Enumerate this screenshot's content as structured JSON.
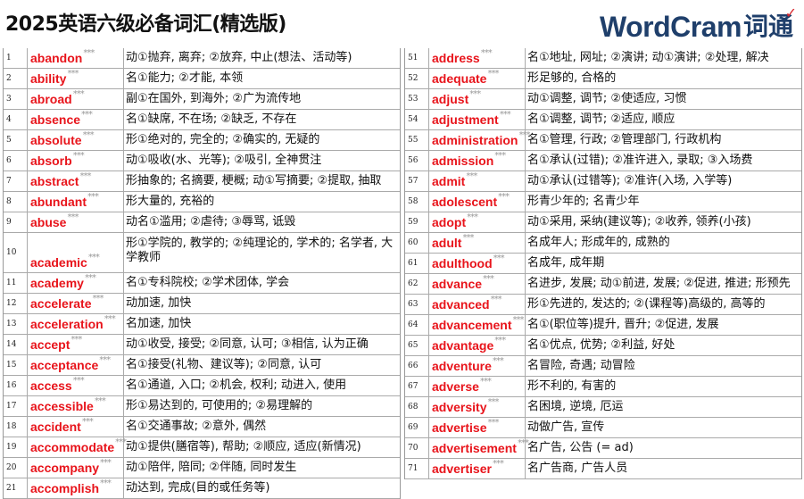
{
  "header": {
    "title": "2025英语六级必备词汇(精选版)",
    "logo_en": "WordCram",
    "logo_cn": "词通"
  },
  "left": [
    {
      "n": "1",
      "word": "abandon",
      "stars": "***",
      "def": "动①抛弃, 离弃; ②放弃, 中止(想法、活动等)"
    },
    {
      "n": "2",
      "word": "ability",
      "stars": "***",
      "def": "名①能力; ②才能, 本领"
    },
    {
      "n": "3",
      "word": "abroad",
      "stars": "***",
      "def": "副①在国外, 到海外; ②广为流传地"
    },
    {
      "n": "4",
      "word": "absence",
      "stars": "***",
      "def": "名①缺席, 不在场; ②缺乏, 不存在"
    },
    {
      "n": "5",
      "word": "absolute",
      "stars": "***",
      "def": "形①绝对的, 完全的; ②确实的, 无疑的"
    },
    {
      "n": "6",
      "word": "absorb",
      "stars": "***",
      "def": "动①吸收(水、光等); ②吸引, 全神贯注"
    },
    {
      "n": "7",
      "word": "abstract",
      "stars": "***",
      "def": "形抽象的; 名摘要, 梗概; 动①写摘要; ②提取, 抽取"
    },
    {
      "n": "8",
      "word": "abundant",
      "stars": "***",
      "def": "形大量的, 充裕的"
    },
    {
      "n": "9",
      "word": "abuse",
      "stars": "***",
      "def": "动名①滥用; ②虐待; ③辱骂, 诋毁"
    },
    {
      "n": "10",
      "word": "academic",
      "stars": "***",
      "def": "形①学院的, 教学的; ②纯理论的, 学术的; 名学者, 大学教师",
      "tall": true
    },
    {
      "n": "11",
      "word": "academy",
      "stars": "***",
      "def": "名①专科院校; ②学术团体, 学会"
    },
    {
      "n": "12",
      "word": "accelerate",
      "stars": "***",
      "def": "动加速, 加快"
    },
    {
      "n": "13",
      "word": "acceleration",
      "stars": "***",
      "def": "名加速, 加快"
    },
    {
      "n": "14",
      "word": "accept",
      "stars": "***",
      "def": "动①收受, 接受; ②同意, 认可; ③相信, 认为正确"
    },
    {
      "n": "15",
      "word": "acceptance",
      "stars": "***",
      "def": "名①接受(礼物、建议等); ②同意, 认可"
    },
    {
      "n": "16",
      "word": "access",
      "stars": "***",
      "def": "名①通道, 入口; ②机会, 权利; 动进入, 使用"
    },
    {
      "n": "17",
      "word": "accessible",
      "stars": "***",
      "def": "形①易达到的, 可使用的; ②易理解的"
    },
    {
      "n": "18",
      "word": "accident",
      "stars": "***",
      "def": "名①交通事故; ②意外, 偶然"
    },
    {
      "n": "19",
      "word": "accommodate",
      "stars": "***",
      "def": "动①提供(膳宿等), 帮助; ②顺应, 适应(新情况)"
    },
    {
      "n": "20",
      "word": "accompany",
      "stars": "***",
      "def": "动①陪伴, 陪同; ②伴随, 同时发生"
    },
    {
      "n": "21",
      "word": "accomplish",
      "stars": "***",
      "def": "动达到, 完成(目的或任务等)"
    }
  ],
  "right": [
    {
      "n": "51",
      "word": "address",
      "stars": "***",
      "def": "名①地址, 网址; ②演讲; 动①演讲; ②处理, 解决"
    },
    {
      "n": "52",
      "word": "adequate",
      "stars": "***",
      "def": "形足够的, 合格的"
    },
    {
      "n": "53",
      "word": "adjust",
      "stars": "***",
      "def": "动①调整, 调节; ②使适应, 习惯"
    },
    {
      "n": "54",
      "word": "adjustment",
      "stars": "***",
      "def": "名①调整, 调节; ②适应, 顺应"
    },
    {
      "n": "55",
      "word": "administration",
      "stars": "***",
      "def": "名①管理, 行政; ②管理部门, 行政机构"
    },
    {
      "n": "56",
      "word": "admission",
      "stars": "***",
      "def": "名①承认(过错); ②准许进入, 录取; ③入场费"
    },
    {
      "n": "57",
      "word": "admit",
      "stars": "***",
      "def": "动①承认(过错等); ②准许(入场, 入学等)"
    },
    {
      "n": "58",
      "word": "adolescent",
      "stars": "***",
      "def": "形青少年的; 名青少年"
    },
    {
      "n": "59",
      "word": "adopt",
      "stars": "***",
      "def": "动①采用, 采纳(建议等); ②收养, 领养(小孩)"
    },
    {
      "n": "60",
      "word": "adult",
      "stars": "***",
      "def": "名成年人; 形成年的, 成熟的"
    },
    {
      "n": "61",
      "word": "adulthood",
      "stars": "***",
      "def": "名成年, 成年期"
    },
    {
      "n": "62",
      "word": "advance",
      "stars": "***",
      "def": "名进步, 发展; 动①前进, 发展; ②促进, 推进; 形预先"
    },
    {
      "n": "63",
      "word": "advanced",
      "stars": "***",
      "def": "形①先进的, 发达的; ②(课程等)高级的, 高等的"
    },
    {
      "n": "64",
      "word": "advancement",
      "stars": "***",
      "def": "名①(职位等)提升, 晋升; ②促进, 发展"
    },
    {
      "n": "65",
      "word": "advantage",
      "stars": "***",
      "def": "名①优点, 优势; ②利益, 好处"
    },
    {
      "n": "66",
      "word": "adventure",
      "stars": "***",
      "def": "名冒险, 奇遇; 动冒险"
    },
    {
      "n": "67",
      "word": "adverse",
      "stars": "***",
      "def": "形不利的, 有害的"
    },
    {
      "n": "68",
      "word": "adversity",
      "stars": "***",
      "def": "名困境, 逆境, 厄运"
    },
    {
      "n": "69",
      "word": "advertise",
      "stars": "***",
      "def": "动做广告, 宣传"
    },
    {
      "n": "70",
      "word": "advertisement",
      "stars": "***",
      "def": "名广告, 公告 (= ad)"
    },
    {
      "n": "71",
      "word": "advertiser",
      "stars": "***",
      "def": "名广告商, 广告人员"
    }
  ]
}
